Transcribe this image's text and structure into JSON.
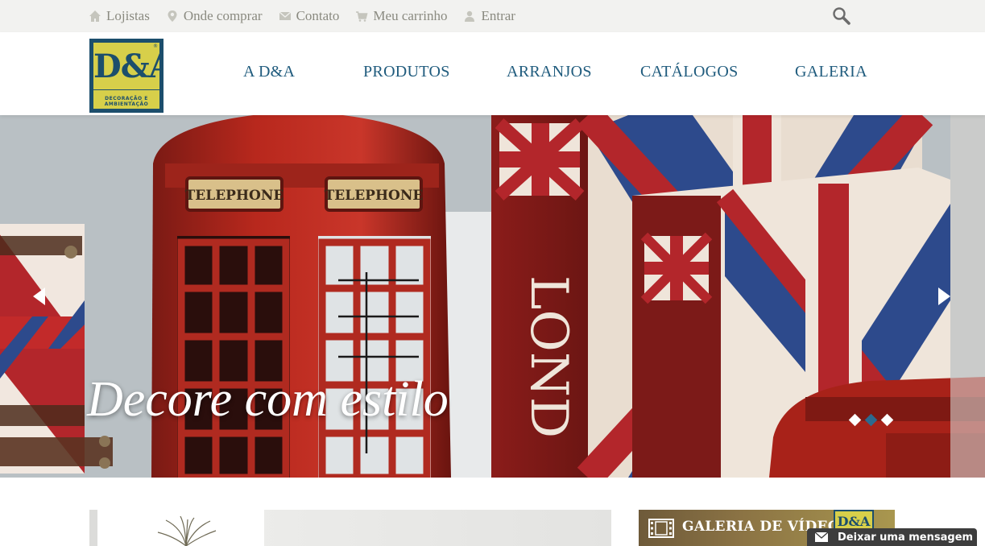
{
  "topbar": {
    "links": [
      {
        "label": "Lojistas",
        "icon": "home-icon"
      },
      {
        "label": "Onde comprar",
        "icon": "map-pin-icon"
      },
      {
        "label": "Contato",
        "icon": "envelope-icon"
      },
      {
        "label": "Meu carrinho",
        "icon": "cart-icon"
      },
      {
        "label": "Entrar",
        "icon": "user-icon"
      }
    ],
    "search_icon": "search-icon"
  },
  "header": {
    "logo": {
      "letters": "D&A",
      "subtitle_line1": "DECORAÇÃO E",
      "subtitle_line2": "AMBIENTAÇÃO",
      "registered": "®"
    },
    "nav": [
      "A D&A",
      "PRODUTOS",
      "ARRANJOS",
      "CATÁLOGOS",
      "GALERIA"
    ]
  },
  "hero": {
    "title": "Decore com estilo",
    "prev_icon": "arrow-left-icon",
    "next_icon": "arrow-right-icon",
    "slide_count": 3,
    "active_slide": 2,
    "booth_sign": "TELEPHONE",
    "book_text": "LOND"
  },
  "video_gallery": {
    "title": "GALERIA DE VÍDEOS",
    "icon": "film-icon",
    "logo_text": "D&A"
  },
  "chat": {
    "label": "Deixar uma mensagem",
    "icon": "envelope-icon"
  },
  "colors": {
    "brand_blue": "#1f5b7d",
    "logo_yellow": "#d7cf4a",
    "topbar_bg": "#f2f2f0",
    "topbar_text": "#8a8a80",
    "dot_active": "#2c6a8f",
    "chat_bg": "#3d3d3d"
  }
}
